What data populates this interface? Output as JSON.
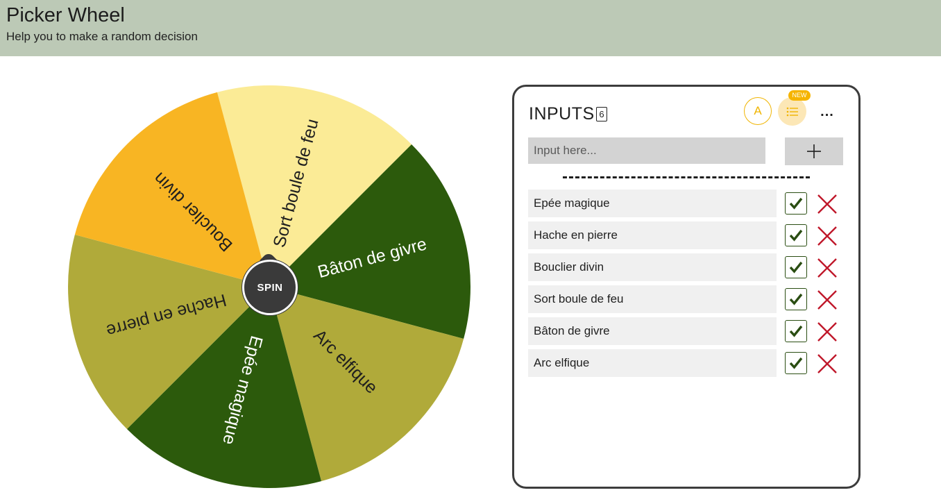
{
  "header": {
    "title": "Picker Wheel",
    "subtitle": "Help you to make a random decision"
  },
  "wheel": {
    "spin_label": "SPIN",
    "slices": [
      {
        "label": "Sort boule de feu",
        "color": "#fbeb96",
        "text_color": "#1f1f1f"
      },
      {
        "label": "Bâton de givre",
        "color": "#2c5a0c",
        "text_color": "#ffffff"
      },
      {
        "label": "Arc elfique",
        "color": "#b0aa3a",
        "text_color": "#1f1f1f"
      },
      {
        "label": "Epée magique",
        "color": "#2c5a0c",
        "text_color": "#ffffff"
      },
      {
        "label": "Hache en pierre",
        "color": "#b0aa3a",
        "text_color": "#1f1f1f"
      },
      {
        "label": "Bouclier divin",
        "color": "#f8b523",
        "text_color": "#1f1f1f"
      }
    ]
  },
  "panel": {
    "title": "INPUTS",
    "count": "6",
    "avatar_letter": "A",
    "new_badge": "NEW",
    "more_label": "...",
    "input_placeholder": "Input here...",
    "entries": [
      {
        "label": "Epée magique",
        "checked": true
      },
      {
        "label": "Hache en pierre",
        "checked": true
      },
      {
        "label": "Bouclier divin",
        "checked": true
      },
      {
        "label": "Sort boule de feu",
        "checked": true
      },
      {
        "label": "Bâton de givre",
        "checked": true
      },
      {
        "label": "Arc elfique",
        "checked": true
      }
    ]
  },
  "colors": {
    "header_bg": "#bcc9b6",
    "accent": "#f0b400",
    "check": "#2a4d12",
    "delete": "#c0182b"
  },
  "icons": {
    "add": "plus-icon",
    "check": "check-icon",
    "delete": "close-icon",
    "list": "list-icon",
    "more": "more-icon"
  }
}
